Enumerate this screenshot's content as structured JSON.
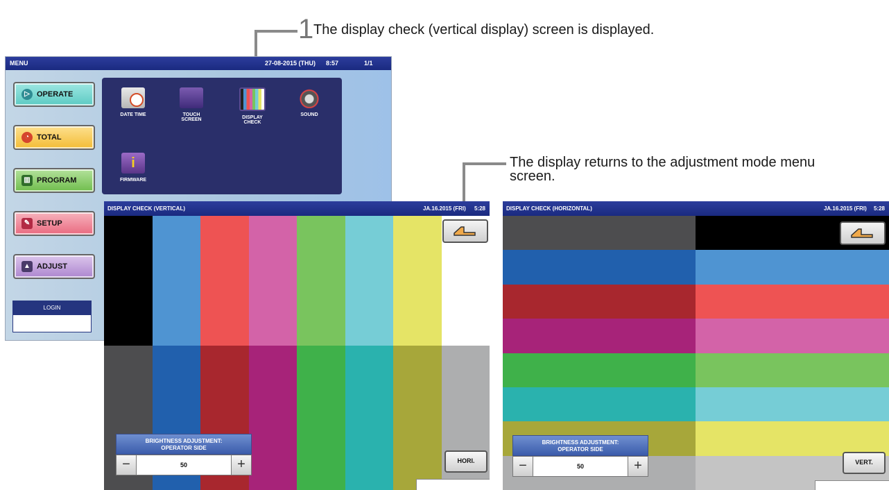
{
  "callouts": {
    "step1_number": "1",
    "step1_text": "The display check (vertical display) screen is displayed.",
    "return_text_line1": "The display returns to the adjustment mode menu",
    "return_text_line2": "screen."
  },
  "menu_screen": {
    "title": "MENU",
    "datetime": "27-08-2015 (THU)",
    "time": "8:57",
    "page": "1/1",
    "buttons": [
      {
        "label": "OPERATE",
        "icon": "play-icon",
        "color": "#67d3cc"
      },
      {
        "label": "TOTAL",
        "icon": "clock-icon",
        "color": "#f6c344"
      },
      {
        "label": "PROGRAM",
        "icon": "book-icon",
        "color": "#79c25a"
      },
      {
        "label": "SETUP",
        "icon": "wrench-icon",
        "color": "#ee7d8f"
      },
      {
        "label": "ADJUST",
        "icon": "adjust-icon",
        "color": "#b48bd0"
      }
    ],
    "tiles": [
      {
        "label_line1": "DATE TIME",
        "label_line2": "",
        "icon": "calendar-clock-icon"
      },
      {
        "label_line1": "TOUCH",
        "label_line2": "SCREEN",
        "icon": "touch-screen-icon"
      },
      {
        "label_line1": "DISPLAY",
        "label_line2": "CHECK",
        "icon": "display-check-icon"
      },
      {
        "label_line1": "SOUND",
        "label_line2": "",
        "icon": "speaker-icon"
      },
      {
        "label_line1": "FIRMWARE",
        "label_line2": "",
        "icon": "info-icon"
      }
    ],
    "login_label": "LOGIN"
  },
  "vertical_screen": {
    "title": "DISPLAY CHECK (VERTICAL)",
    "datetime": "JA.16.2015 (FRI)",
    "time": "5:28",
    "bars_top": [
      "#000000",
      "#4f94d2",
      "#ee5353",
      "#d363a8",
      "#79c45e",
      "#76cdd6",
      "#e5e466",
      "#ffffff"
    ],
    "bars_bottom": [
      "#4d4d4f",
      "#2160ad",
      "#a8272e",
      "#a72379",
      "#3fb14a",
      "#2ab2ae",
      "#a7a73a",
      "#adaeaf"
    ],
    "brightness_title_line1": "BRIGHTNESS ADJUSTMENT:",
    "brightness_title_line2": "OPERATOR SIDE",
    "brightness_minus": "−",
    "brightness_value": "50",
    "brightness_plus": "+",
    "mode_button": "HORI."
  },
  "horizontal_screen": {
    "title": "DISPLAY CHECK (HORIZONTAL)",
    "datetime": "JA.16.2015 (FRI)",
    "time": "5:28",
    "rows_left": [
      "#4d4d4f",
      "#2160ad",
      "#a8272e",
      "#a72379",
      "#3fb14a",
      "#2ab2ae",
      "#a7a73a",
      "#adaeaf"
    ],
    "rows_right": [
      "#000000",
      "#4f94d2",
      "#ee5353",
      "#d363a8",
      "#79c45e",
      "#76cdd6",
      "#e5e466",
      "#c4c4c4"
    ],
    "brightness_title_line1": "BRIGHTNESS ADJUSTMENT:",
    "brightness_title_line2": "OPERATOR SIDE",
    "brightness_minus": "−",
    "brightness_value": "50",
    "brightness_plus": "+",
    "mode_button": "VERT."
  }
}
